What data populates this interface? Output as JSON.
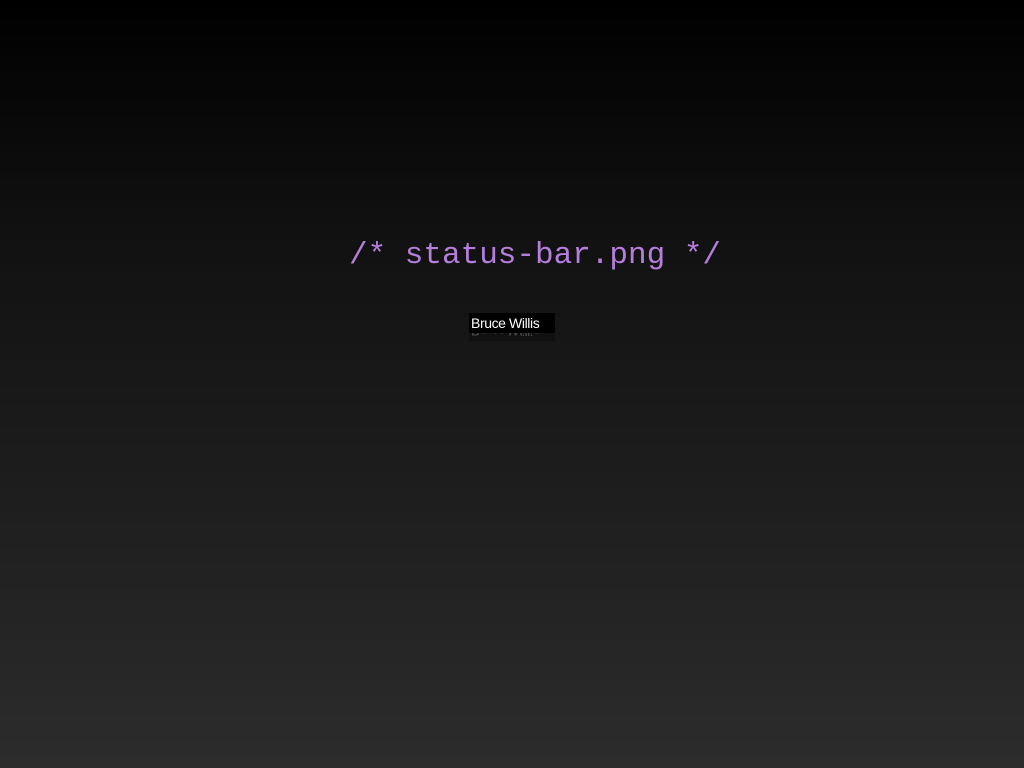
{
  "slide": {
    "caption": "/* status-bar.png */",
    "status_bar": {
      "label": "Bruce Willis"
    }
  },
  "colors": {
    "caption_text": "#b57edc",
    "status_bar_bg": "#000000",
    "status_bar_text": "#ffffff"
  }
}
